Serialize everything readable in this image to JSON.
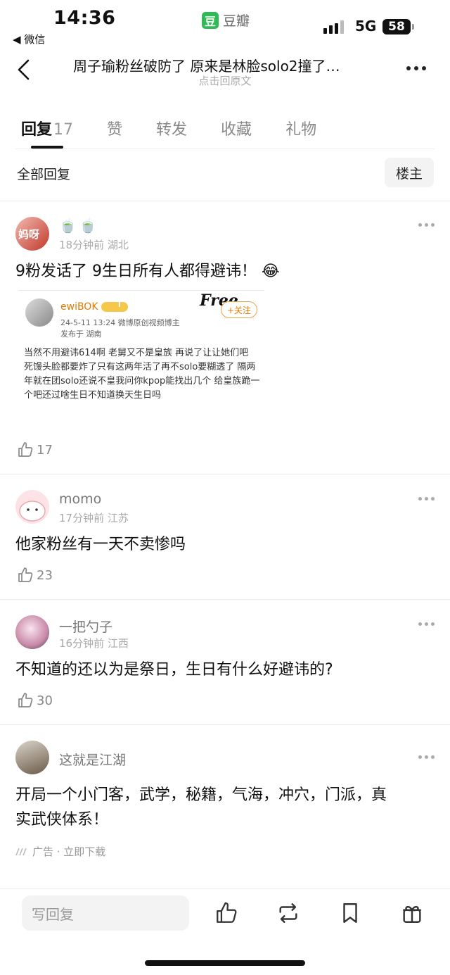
{
  "status_bar": {
    "time": "14:36",
    "back_app": "◀ 微信",
    "app_logo": "豆",
    "app_name": "豆瓣",
    "network": "5G",
    "battery": "58"
  },
  "header": {
    "title": "周子瑜粉丝破防了 原来是林脸solo2撞了…",
    "subtitle": "点击回原文"
  },
  "tabs": [
    {
      "label": "回复",
      "count": "17"
    },
    {
      "label": "赞"
    },
    {
      "label": "转发"
    },
    {
      "label": "收藏"
    },
    {
      "label": "礼物"
    }
  ],
  "section": {
    "title": "全部回复",
    "owner_button": "楼主"
  },
  "comments": [
    {
      "avatar_text": "妈呀",
      "badges": [
        "🍵",
        "🍵"
      ],
      "meta": "18分钟前  湖北",
      "content": "9粉发话了 9生日所有人都得避讳！ 😂",
      "likes": "17",
      "embed": {
        "name": "ewiBOK",
        "vip": "I",
        "date": "24-5-11 13:24  微博原创视频博主",
        "location": "发布于 湖南",
        "follow": "+关注",
        "signature": "Free",
        "text": "当然不用避讳614啊 老舅又不是皇族 再说了让让她们吧 死馒头脸都要炸了只有这两年活了再不solo要糊透了 隔两年就在团solo还说不皇我问你kpop能找出几个 给皇族跪一个吧还过啥生日不知道换天生日吗"
      }
    },
    {
      "name": "momo",
      "meta": "17分钟前  江苏",
      "content": "他家粉丝有一天不卖惨吗",
      "likes": "23"
    },
    {
      "name": "一把勺子",
      "meta": "16分钟前  江西",
      "content": "不知道的还以为是祭日，生日有什么好避讳的?",
      "likes": "30"
    }
  ],
  "ad": {
    "name": "这就是江湖",
    "content_line1": "开局一个小门客，武学，秘籍，气海，冲穴，门派，真",
    "content_line2": "实武侠体系！",
    "label": "广告 · 立即下载"
  },
  "bottom_bar": {
    "reply_placeholder": "写回复"
  },
  "icons": [
    "chevron-left-icon",
    "more-icon",
    "thumb-up-icon",
    "repost-icon",
    "bookmark-icon",
    "gift-icon"
  ]
}
